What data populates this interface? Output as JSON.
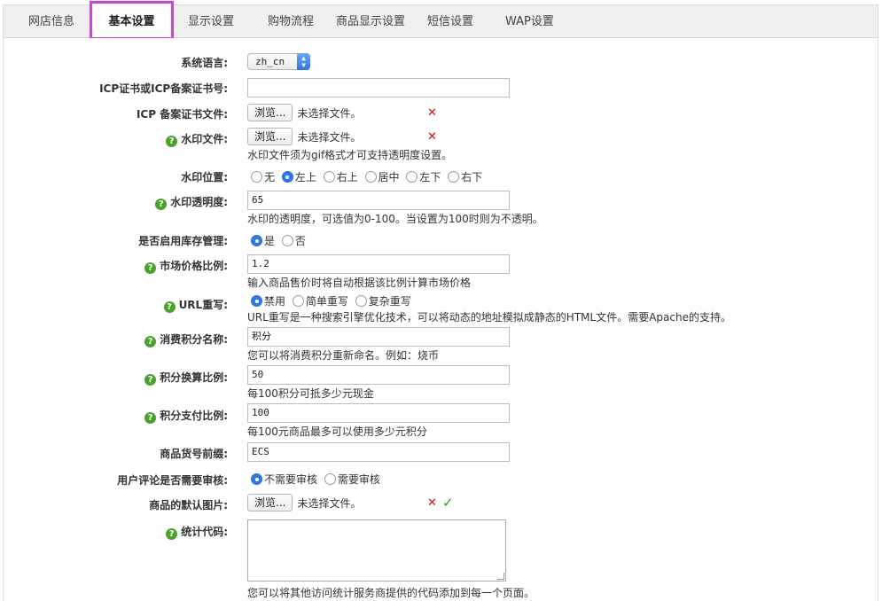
{
  "tabs": [
    {
      "label": "网店信息"
    },
    {
      "label": "基本设置"
    },
    {
      "label": "显示设置"
    },
    {
      "label": "购物流程"
    },
    {
      "label": "商品显示设置"
    },
    {
      "label": "短信设置"
    },
    {
      "label": "WAP设置"
    }
  ],
  "form": {
    "language": {
      "label": "系统语言:",
      "value": "zh_cn"
    },
    "icp_no": {
      "label": "ICP证书或ICP备案证书号:",
      "value": ""
    },
    "icp_file": {
      "label": "ICP 备案证书文件:",
      "button": "浏览...",
      "status": "未选择文件。"
    },
    "watermark_file": {
      "label": "水印文件:",
      "button": "浏览...",
      "status": "未选择文件。",
      "hint": "水印文件须为gif格式才可支持透明度设置。"
    },
    "watermark_pos": {
      "label": "水印位置:",
      "options": [
        "无",
        "左上",
        "右上",
        "居中",
        "左下",
        "右下"
      ],
      "selected": "左上"
    },
    "watermark_alpha": {
      "label": "水印透明度:",
      "value": "65",
      "hint": "水印的透明度，可选值为0-100。当设置为100时则为不透明。"
    },
    "stock": {
      "label": "是否启用库存管理:",
      "options": [
        "是",
        "否"
      ],
      "selected": "是"
    },
    "market_ratio": {
      "label": "市场价格比例:",
      "value": "1.2",
      "hint": "输入商品售价时将自动根据该比例计算市场价格"
    },
    "url_rewrite": {
      "label": "URL重写:",
      "options": [
        "禁用",
        "简单重写",
        "复杂重写"
      ],
      "selected": "禁用",
      "hint": "URL重写是一种搜索引擎优化技术，可以将动态的地址模拟成静态的HTML文件。需要Apache的支持。"
    },
    "points_name": {
      "label": "消费积分名称:",
      "value": "积分",
      "hint": "您可以将消费积分重新命名。例如：烧币"
    },
    "points_rate": {
      "label": "积分换算比例:",
      "value": "50",
      "hint": "每100积分可抵多少元现金"
    },
    "points_pay": {
      "label": "积分支付比例:",
      "value": "100",
      "hint": "每100元商品最多可以使用多少元积分"
    },
    "sn_prefix": {
      "label": "商品货号前缀:",
      "value": "ECS"
    },
    "comment_check": {
      "label": "用户评论是否需要审核:",
      "options": [
        "不需要审核",
        "需要审核"
      ],
      "selected": "不需要审核"
    },
    "default_image": {
      "label": "商品的默认图片:",
      "button": "浏览...",
      "status": "未选择文件。"
    },
    "stats_code": {
      "label": "统计代码:",
      "value": "",
      "hint": "您可以将其他访问统计服务商提供的代码添加到每一个页面。"
    }
  }
}
